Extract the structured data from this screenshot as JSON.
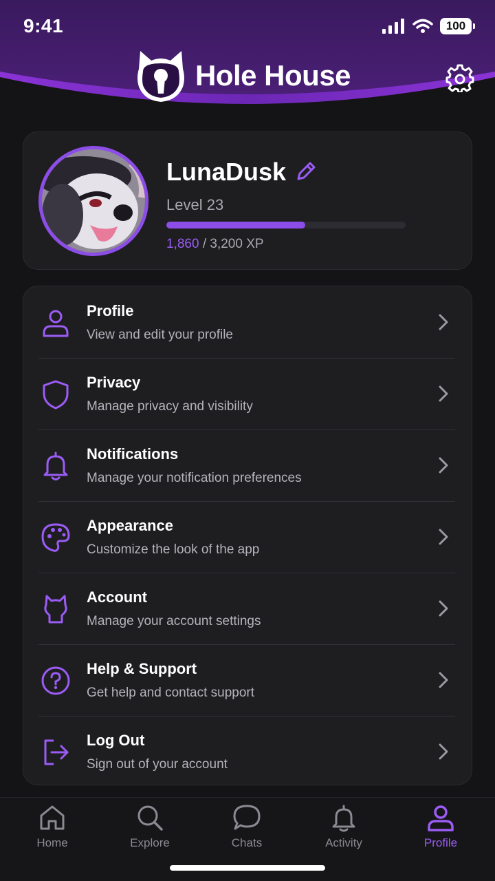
{
  "status_bar": {
    "time": "9:41",
    "battery": "100"
  },
  "header": {
    "title": "Hole House"
  },
  "colors": {
    "accent": "#8d4de8",
    "accent_light": "#9b5cf5",
    "header_top": "#3a1a5e",
    "header_band": "#7b2fc4"
  },
  "profile": {
    "username": "LunaDusk",
    "level": "Level 23",
    "xp_current": "1,860",
    "xp_total": " / 3,200 XP",
    "xp_progress": 0.58
  },
  "menu": [
    {
      "icon": "user-icon",
      "title": "Profile",
      "subtitle": "View and edit your profile"
    },
    {
      "icon": "shield-icon",
      "title": "Privacy",
      "subtitle": "Manage privacy and visibility"
    },
    {
      "icon": "bell-icon",
      "title": "Notifications",
      "subtitle": "Manage your notification preferences"
    },
    {
      "icon": "palette-icon",
      "title": "Appearance",
      "subtitle": "Customize the look of the app"
    },
    {
      "icon": "cat-head-icon",
      "title": "Account",
      "subtitle": "Manage your account settings"
    },
    {
      "icon": "help-circle-icon",
      "title": "Help & Support",
      "subtitle": "Get help and contact support"
    },
    {
      "icon": "logout-icon",
      "title": "Log Out",
      "subtitle": "Sign out of your account"
    }
  ],
  "tabs": [
    {
      "icon": "home-icon",
      "label": "Home"
    },
    {
      "icon": "search-icon",
      "label": "Explore"
    },
    {
      "icon": "chat-bubble-icon",
      "label": "Chats"
    },
    {
      "icon": "bell-icon",
      "label": "Activity"
    },
    {
      "icon": "user-icon",
      "label": "Profile",
      "active": true
    }
  ]
}
